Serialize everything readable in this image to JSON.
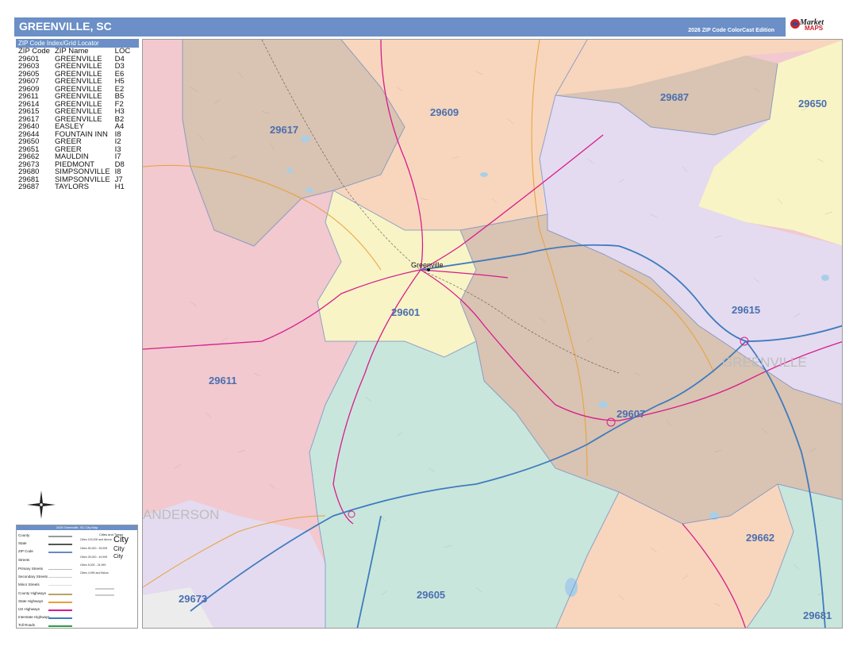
{
  "header": {
    "title": "GREENVILLE, SC",
    "edition": "2026 ZIP Code ColorCast Edition"
  },
  "logo": {
    "brand_top": "Market",
    "brand_bottom": "MAPS"
  },
  "zip_index": {
    "title": "ZIP Code Index/Grid Locator",
    "columns": [
      "ZIP Code",
      "ZIP Name",
      "LOC"
    ],
    "rows": [
      [
        "29601",
        "GREENVILLE",
        "D4"
      ],
      [
        "29603",
        "GREENVILLE",
        "D3"
      ],
      [
        "29605",
        "GREENVILLE",
        "E6"
      ],
      [
        "29607",
        "GREENVILLE",
        "H5"
      ],
      [
        "29609",
        "GREENVILLE",
        "E2"
      ],
      [
        "29611",
        "GREENVILLE",
        "B5"
      ],
      [
        "29614",
        "GREENVILLE",
        "F2"
      ],
      [
        "29615",
        "GREENVILLE",
        "H3"
      ],
      [
        "29617",
        "GREENVILLE",
        "B2"
      ],
      [
        "29640",
        "EASLEY",
        "A4"
      ],
      [
        "29644",
        "FOUNTAIN INN",
        "I8"
      ],
      [
        "29650",
        "GREER",
        "I2"
      ],
      [
        "29651",
        "GREER",
        "I3"
      ],
      [
        "29662",
        "MAULDIN",
        "I7"
      ],
      [
        "29673",
        "PIEDMONT",
        "D8"
      ],
      [
        "29680",
        "SIMPSONVILLE",
        "I8"
      ],
      [
        "29681",
        "SIMPSONVILLE",
        "J7"
      ],
      [
        "29687",
        "TAYLORS",
        "H1"
      ]
    ]
  },
  "map": {
    "zip_labels": {
      "z29609": "29609",
      "z29687": "29687",
      "z29650": "29650",
      "z29617": "29617",
      "z29615": "29615",
      "z29601": "29601",
      "z29611": "29611",
      "z29607": "29607",
      "z29662": "29662",
      "z29605": "29605",
      "z29673": "29673",
      "z29681": "29681"
    },
    "city_labels": {
      "greenville": "Greenville",
      "greenville_big": "GREENVILLE",
      "anderson_big": "ANDERSON"
    },
    "colors": {
      "pink": "#f1c9cf",
      "peach": "#f7d6bd",
      "tan": "#d9c3b2",
      "lavender": "#e4dbf0",
      "yellow": "#f8f4c6",
      "teal": "#c9e6dc",
      "highway_us": "#d81b8c",
      "interstate": "#3e7bbf",
      "state_hwy": "#e8a13a",
      "zip_boundary": "#6a88c2",
      "water": "#a9cfe8"
    }
  },
  "legend": {
    "title": "2026 Greenville, SC City Map",
    "items": {
      "county": "County",
      "state": "State",
      "zip": "ZIP Code",
      "streets": "Streets",
      "primary": "Primary Streets",
      "secondary": "Secondary Streets",
      "minor": "Minor Streets",
      "county_hwy": "County Highways",
      "state_hwy": "State Highways",
      "us_hwy": "US Highways",
      "interstate": "Interstate Highways",
      "toll": "Toll Roads"
    },
    "cities_title": "Cities and Towns",
    "city_rows": {
      "r1": "Cities 100,000 and Above",
      "r2": "Cities 50,000 - 99,999",
      "r3": "Cities 25,000 - 49,999",
      "r4": "Cities 5,000 - 24,999",
      "r5": "Cities 4,999 and Below"
    },
    "city_names": {
      "n1": "City",
      "n2": "City",
      "n3": "City"
    }
  }
}
